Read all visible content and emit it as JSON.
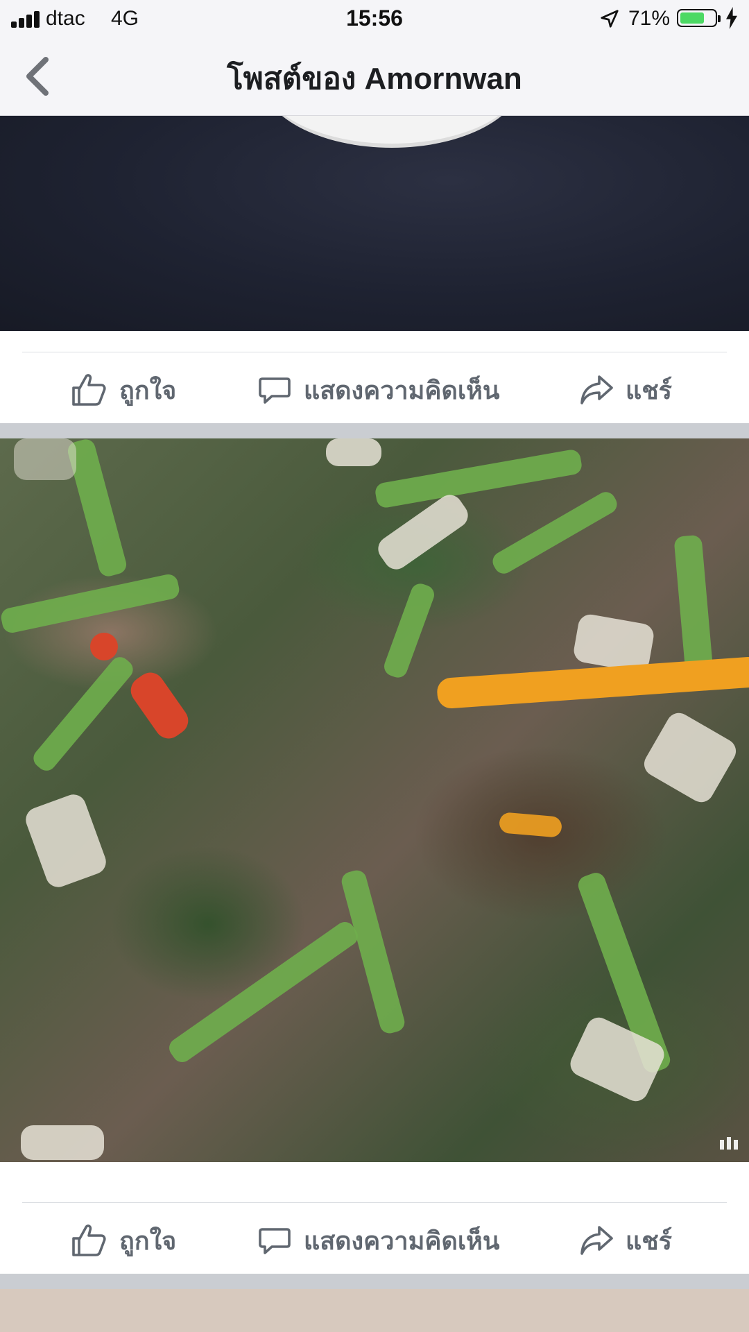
{
  "status_bar": {
    "carrier": "dtac",
    "network": "4G",
    "time": "15:56",
    "battery_percent": "71%",
    "battery_level": 0.71
  },
  "header": {
    "title": "โพสต์ของ Amornwan"
  },
  "posts": [
    {
      "actions": {
        "like": "ถูกใจ",
        "comment": "แสดงความคิดเห็น",
        "share": "แชร์"
      }
    },
    {
      "actions": {
        "like": "ถูกใจ",
        "comment": "แสดงความคิดเห็น",
        "share": "แชร์"
      }
    }
  ],
  "colors": {
    "header_bg": "#f5f5f8",
    "action_text": "#606770",
    "battery_fill": "#4cd964",
    "divider": "#cacdd2"
  }
}
